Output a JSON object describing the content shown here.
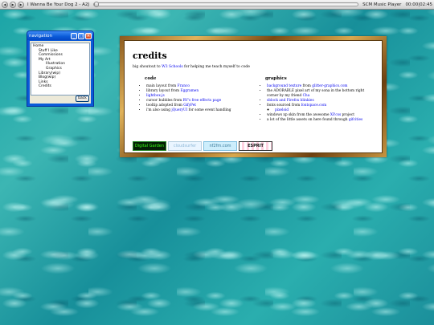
{
  "player": {
    "track": "I Wanna Be Your Dog 2 - A2J",
    "name": "SCM Music Player",
    "time": "00:00|02:45",
    "progress_fraction": 0.0
  },
  "nav": {
    "title": "navigation",
    "items": [
      {
        "label": "Home",
        "level": 0
      },
      {
        "label": "Stuff I Like",
        "level": 1
      },
      {
        "label": "Commissions",
        "level": 1
      },
      {
        "label": "My Art",
        "level": 1
      },
      {
        "label": "Illustration",
        "level": 2
      },
      {
        "label": "Graphics",
        "level": 2
      },
      {
        "label": "Library(wip)",
        "level": 1
      },
      {
        "label": "Blog(wip)",
        "level": 1
      },
      {
        "label": "Links",
        "level": 1
      },
      {
        "label": "Credits",
        "level": 1
      }
    ],
    "back_label": "back"
  },
  "credits": {
    "title": "credits",
    "intro_prefix": "big shoutout to ",
    "intro_link": "W3 Schools",
    "intro_suffix": " for helping me teach myself to code",
    "code_heading": "code",
    "code_items": [
      {
        "pre": "main layout from ",
        "link": "Franco",
        "post": ""
      },
      {
        "pre": "library layout from ",
        "link": "Eggramen",
        "post": ""
      },
      {
        "pre": "",
        "link": "lightbox.js",
        "post": ""
      },
      {
        "pre": "cursor bubbles from ",
        "link": "RV's free effects page",
        "post": ""
      },
      {
        "pre": "tooltip adopted from ",
        "link": "GifyPet",
        "post": ""
      },
      {
        "pre": "i'm also using ",
        "link": "jQueryUI",
        "post": " for some event handling"
      }
    ],
    "graphics_heading": "graphics",
    "graphics_items": [
      {
        "pre": "",
        "link": "background texture",
        "mid": " from ",
        "link2": "glitter-graphics.com",
        "post": ""
      },
      {
        "pre": "the ADORABLE pixel art of my sona in the bottom right corner by my friend ",
        "link": "Cha",
        "mid": "",
        "link2": "",
        "post": ""
      },
      {
        "pre": "",
        "link": "sblock and Firefox blinkies",
        "mid": "",
        "link2": "",
        "post": ""
      },
      {
        "pre": "fonts sourced from ",
        "link": "fontspace.com",
        "mid": "",
        "link2": "",
        "post": ""
      },
      {
        "pre": "windows xp skin from the awesome ",
        "link": "XP.css",
        "mid": "",
        "link2": "",
        "post": " project"
      },
      {
        "pre": "a lot of the little assets on here found through ",
        "link": "gifcities",
        "mid": "",
        "link2": "",
        "post": ""
      }
    ],
    "sub_item": "pixeloid",
    "badges": [
      "Digital Garden",
      "cloudsurfer",
      "nf2fm.com",
      "ESPRIT"
    ]
  }
}
